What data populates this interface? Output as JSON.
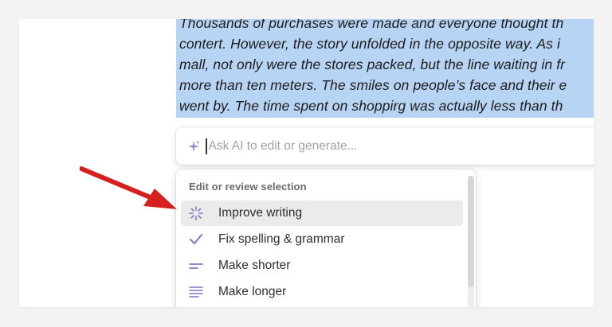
{
  "document": {
    "lines": [
      "Thousands of purchases were made and everyone thought th",
      "contert. However, the story unfolded in the opposite way. As i",
      "mall, not only were the stores packed, but the line waiting in fr",
      "more than ten meters. The smiles on people’s face and their e",
      "went by. The time spent on shoppirg was actually less than th"
    ]
  },
  "ai_prompt": {
    "placeholder": "Ask AI to edit or generate...",
    "icon": "sparkle-icon"
  },
  "menu": {
    "section_title": "Edit or review selection",
    "items": [
      {
        "label": "Improve writing",
        "icon": "magic-wand-icon",
        "active": true
      },
      {
        "label": "Fix spelling & grammar",
        "icon": "check-icon",
        "active": false
      },
      {
        "label": "Make shorter",
        "icon": "short-lines-icon",
        "active": false
      },
      {
        "label": "Make longer",
        "icon": "long-lines-icon",
        "active": false
      }
    ]
  },
  "colors": {
    "selection": "#b8d4f5",
    "menu_icon": "#8a73c4",
    "arrow": "#d61f1f",
    "active_row": "#ebebea"
  }
}
